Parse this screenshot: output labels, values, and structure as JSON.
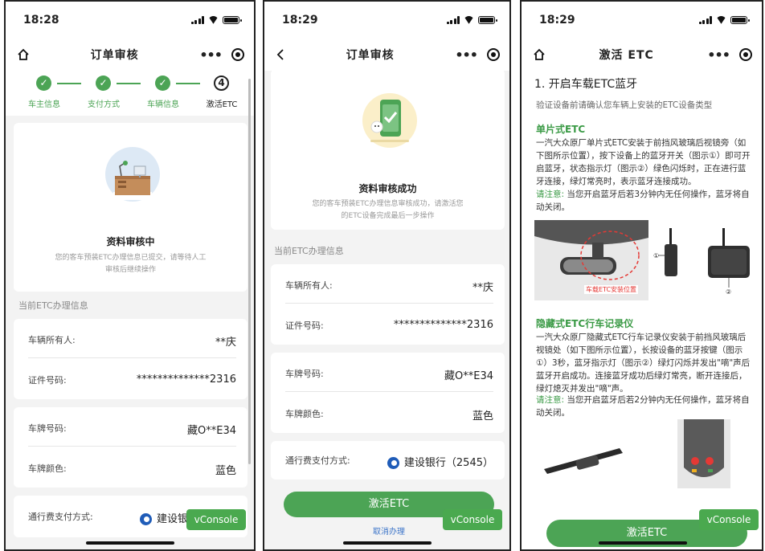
{
  "colors": {
    "accent": "#4ca455",
    "link": "#3d75c9",
    "bank": "#1f5cb8"
  },
  "screens": [
    {
      "time": "18:28",
      "nav_title": "订单审核",
      "steps": [
        {
          "label": "车主信息",
          "state": "done"
        },
        {
          "label": "支付方式",
          "state": "done"
        },
        {
          "label": "车辆信息",
          "state": "done"
        },
        {
          "label": "激活ETC",
          "state": "current",
          "number": "4"
        }
      ],
      "status_title": "资料审核中",
      "status_desc_1": "您的客车预装ETC办理信息已提交，请等待人工",
      "status_desc_2": "审核后继续操作",
      "section_title": "当前ETC办理信息",
      "rows": [
        {
          "label": "车辆所有人:",
          "value": "**庆"
        },
        {
          "label": "证件号码:",
          "value": "**************2316"
        },
        {
          "label": "车牌号码:",
          "value": "藏O**E34"
        },
        {
          "label": "车牌颜色:",
          "value": "蓝色"
        },
        {
          "label": "通行费支付方式:",
          "value": "建设银"
        }
      ],
      "vconsole": "vConsole"
    },
    {
      "time": "18:29",
      "nav_title": "订单审核",
      "status_title": "资料审核成功",
      "status_desc_1": "您的客车预装ETC办理信息审核成功，请激活您",
      "status_desc_2": "的ETC设备完成最后一步操作",
      "section_title": "当前ETC办理信息",
      "rows": [
        {
          "label": "车辆所有人:",
          "value": "**庆"
        },
        {
          "label": "证件号码:",
          "value": "**************2316"
        },
        {
          "label": "车牌号码:",
          "value": "藏O**E34"
        },
        {
          "label": "车牌颜色:",
          "value": "蓝色"
        },
        {
          "label": "通行费支付方式:",
          "value": "建设银行（2545）"
        }
      ],
      "primary_button": "激活ETC",
      "cancel_link": "取消办理",
      "vconsole": "vConsole"
    },
    {
      "time": "18:29",
      "nav_title": "激活 ETC",
      "heading": "1. 开启车载ETC蓝牙",
      "intro": "验证设备前请确认您车辆上安装的ETC设备类型",
      "type1_title": "单片式ETC",
      "type1_body": "一汽大众原厂单片式ETC安装于前挡风玻璃后视镜旁（如下图所示位置），按下设备上的蓝牙开关（图示①）即可开启蓝牙，状态指示灯（图示②）绿色闪烁时，正在进行蓝牙连接，绿灯常亮时，表示蓝牙连接成功。",
      "type1_note_label": "请注意:",
      "type1_note": "当您开启蓝牙后若3分钟内无任何操作，蓝牙将自动关闭。",
      "image_caption": "车载ETC安装位置",
      "marker_1": "①",
      "marker_2": "②",
      "type2_title": "隐藏式ETC行车记录仪",
      "type2_body": "一汽大众原厂隐藏式ETC行车记录仪安装于前挡风玻璃后视镜处（如下图所示位置），长按设备的蓝牙按键（图示①）3秒，蓝牙指示灯（图示②）绿灯闪烁并发出\"嘀\"声后蓝牙开启成功。连接蓝牙成功后绿灯常亮，断开连接后，绿灯熄灭并发出\"嘀\"声。",
      "type2_note_label": "请注意:",
      "type2_note": "当您开启蓝牙后若2分钟内无任何操作，蓝牙将自动关闭。",
      "primary_button": "激活ETC",
      "vconsole": "vConsole"
    }
  ]
}
